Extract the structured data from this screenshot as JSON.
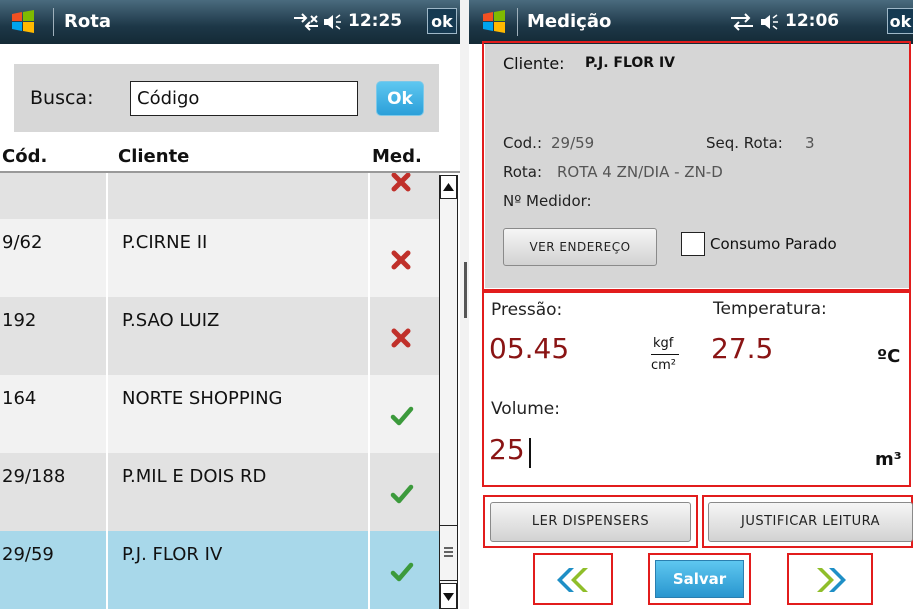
{
  "left": {
    "title": "Rota",
    "time": "12:25",
    "ok_label": "ok",
    "search": {
      "label": "Busca:",
      "value": "Código",
      "button": "Ok"
    },
    "columns": [
      "Cód.",
      "Cliente",
      "Med."
    ],
    "rows": [
      {
        "cod": "",
        "cliente": "",
        "med": "x",
        "selected": false
      },
      {
        "cod": "9/62",
        "cliente": "P.CIRNE II",
        "med": "x",
        "selected": false
      },
      {
        "cod": "192",
        "cliente": "P.SAO LUIZ",
        "med": "x",
        "selected": false
      },
      {
        "cod": "164",
        "cliente": "NORTE SHOPPING",
        "med": "check",
        "selected": false
      },
      {
        "cod": "29/188",
        "cliente": "P.MIL E DOIS RD",
        "med": "check",
        "selected": false
      },
      {
        "cod": "29/59",
        "cliente": "P.J. FLOR IV",
        "med": "check",
        "selected": true
      }
    ]
  },
  "right": {
    "title": "Medição",
    "time": "12:06",
    "ok_label": "ok",
    "cliente_label": "Cliente:",
    "cliente_value": "P.J. FLOR IV",
    "cod_label": "Cod.:",
    "cod_value": "29/59",
    "seq_label": "Seq. Rota:",
    "seq_value": "3",
    "rota_label": "Rota:",
    "rota_value": "ROTA 4 ZN/DIA - ZN-D",
    "medidor_label": "Nº Medidor:",
    "ver_endereco": "VER ENDEREÇO",
    "consumo_parado": "Consumo Parado",
    "pressao_label": "Pressão:",
    "pressao_value": "05.45",
    "pressao_unit_num": "kgf",
    "pressao_unit_den": "cm²",
    "temperatura_label": "Temperatura:",
    "temperatura_value": "27.5",
    "temperatura_unit": "ºC",
    "volume_label": "Volume:",
    "volume_value": "25",
    "volume_unit": "m³",
    "ler_dispensers": "LER DISPENSERS",
    "justificar_leitura": "JUSTIFICAR LEITURA",
    "salvar": "Salvar"
  },
  "colors": {
    "selected_row": "#a8d8ea",
    "alt_row": "#e2e2e2",
    "accent": "#2b9fd9",
    "value_red": "#8a1414",
    "outline_red": "#e21c1c"
  },
  "icons": [
    "windows-logo-icon",
    "connectivity-icon",
    "volume-icon",
    "red-x-icon",
    "green-check-icon",
    "double-chevron-left-icon",
    "double-chevron-right-icon"
  ]
}
